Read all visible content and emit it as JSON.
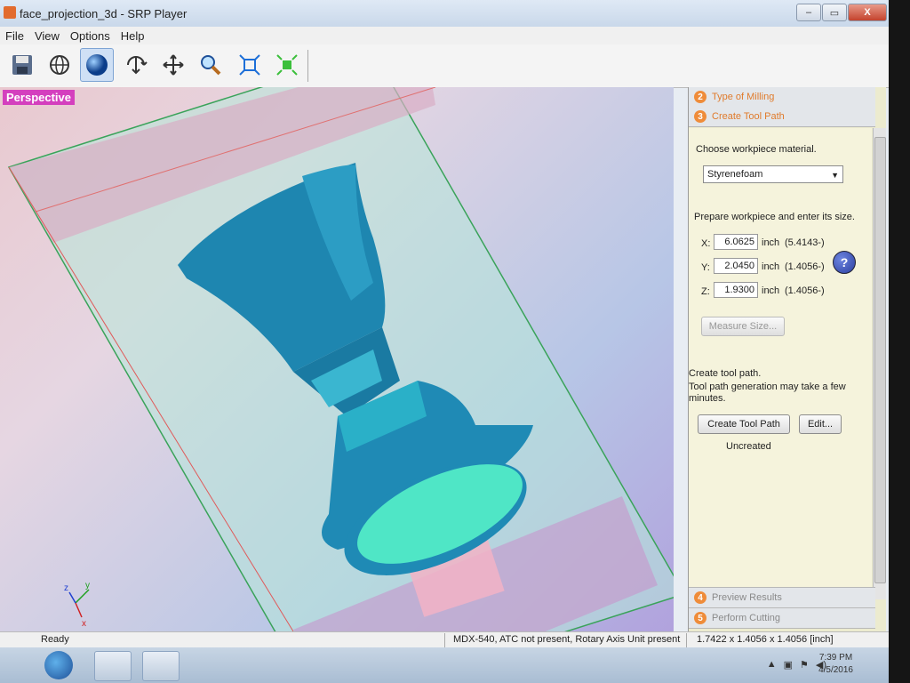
{
  "window": {
    "title": "face_projection_3d - SRP Player",
    "controls": {
      "minimize": "–",
      "maximize": "▭",
      "close": "X"
    }
  },
  "menu": [
    "File",
    "View",
    "Options",
    "Help"
  ],
  "toolbar": {
    "tools": [
      "save-icon",
      "globe-icon",
      "sphere-icon",
      "rotate-icon",
      "pan-icon",
      "zoom-icon",
      "fit-icon",
      "perspective-icon"
    ],
    "active_tool": "sphere-icon"
  },
  "viewport": {
    "label": "Perspective",
    "axes": {
      "x": "x",
      "y": "y",
      "z": "z"
    }
  },
  "panel": {
    "steps": [
      {
        "number": "2",
        "label": "Type of Milling"
      },
      {
        "number": "3",
        "label": "Create Tool Path"
      },
      {
        "number": "4",
        "label": "Preview Results"
      },
      {
        "number": "5",
        "label": "Perform Cutting"
      }
    ],
    "material_prompt": "Choose workpiece material.",
    "material_value": "Styrenefoam",
    "size_prompt": "Prepare workpiece and enter its size.",
    "dimensions": [
      {
        "axis": "X:",
        "value": "6.0625",
        "unit": "inch",
        "original": "(5.4143-)"
      },
      {
        "axis": "Y:",
        "value": "2.0450",
        "unit": "inch",
        "original": "(1.4056-)"
      },
      {
        "axis": "Z:",
        "value": "1.9300",
        "unit": "inch",
        "original": "(1.4056-)"
      }
    ],
    "help_label": "?",
    "measure_size_label": "Measure Size...",
    "toolpath_title": "Create tool path.",
    "toolpath_note": "Tool path generation may take a few minutes.",
    "create_toolpath_label": "Create Tool Path",
    "edit_label": "Edit...",
    "toolpath_status": "Uncreated"
  },
  "statusbar": {
    "ready": "Ready",
    "machine": "MDX-540, ATC not present, Rotary Axis Unit present",
    "size": "1.7422 x 1.4056 x 1.4056 [inch]"
  },
  "taskbar": {
    "time": "7:39 PM",
    "date": "4/5/2016"
  }
}
